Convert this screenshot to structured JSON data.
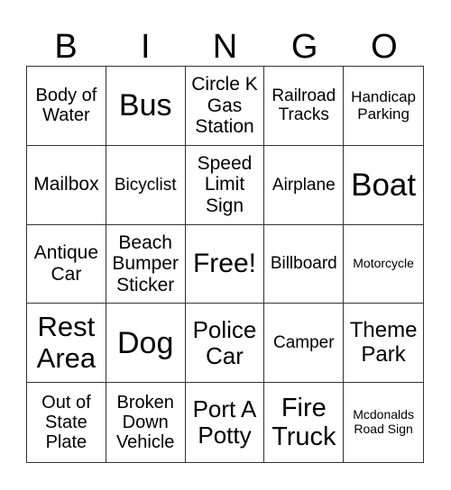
{
  "header": {
    "letters": [
      "B",
      "I",
      "N",
      "G",
      "O"
    ]
  },
  "cells": [
    "Body of Water",
    "Bus",
    "Circle K Gas Station",
    "Railroad Tracks",
    "Handicap Parking",
    "Mailbox",
    "Bicyclist",
    "Speed Limit Sign",
    "Airplane",
    "Boat",
    "Antique Car",
    "Beach Bumper Sticker",
    "Free!",
    "Billboard",
    "Motorcycle",
    "Rest Area",
    "Dog",
    "Police Car",
    "Camper",
    "Theme Park",
    "Out of State Plate",
    "Broken Down Vehicle",
    "Port A Potty",
    "Fire Truck",
    "Mcdonalds Road Sign"
  ]
}
